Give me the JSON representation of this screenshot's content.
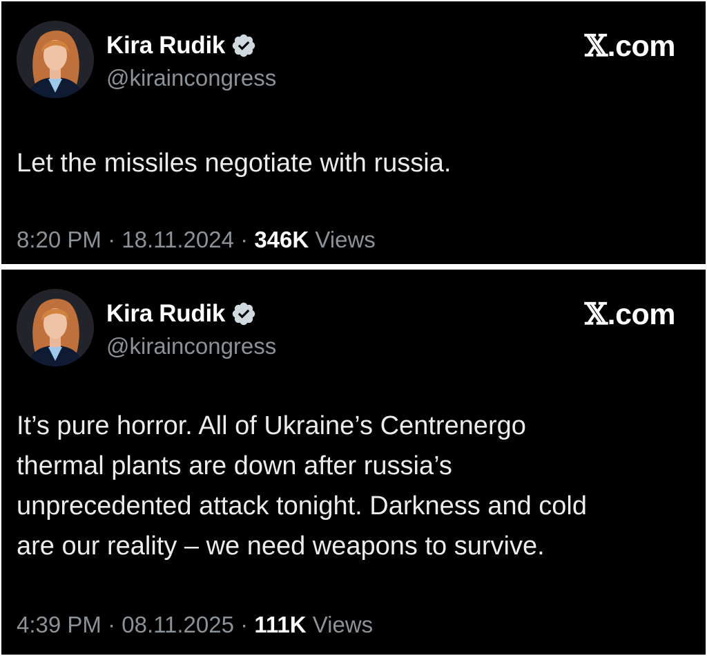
{
  "tweets": [
    {
      "author_name": "Kira Rudik",
      "handle": "@kiraincongress",
      "brand_x": "𝕏",
      "brand_tld": ".com",
      "text": "Let the missiles negotiate with russia.",
      "time": "8:20 PM",
      "date": "18.11.2024",
      "separator": "·",
      "views_count": "346K",
      "views_label": "Views",
      "verified_color": "#cfd9de"
    },
    {
      "author_name": "Kira Rudik",
      "handle": "@kiraincongress",
      "brand_x": "𝕏",
      "brand_tld": ".com",
      "text": "It’s pure horror. All of Ukraine’s Centrenergo\nthermal plants are down after russia’s\nunprecedented attack tonight. Darkness and cold\nare our reality – we need weapons to survive.",
      "time": "4:39 PM",
      "date": "08.11.2025",
      "separator": "·",
      "views_count": "111K",
      "views_label": "Views",
      "verified_color": "#cfd9de"
    }
  ],
  "colors": {
    "background": "#000000",
    "text": "#ececec",
    "secondary": "#8b9298"
  }
}
